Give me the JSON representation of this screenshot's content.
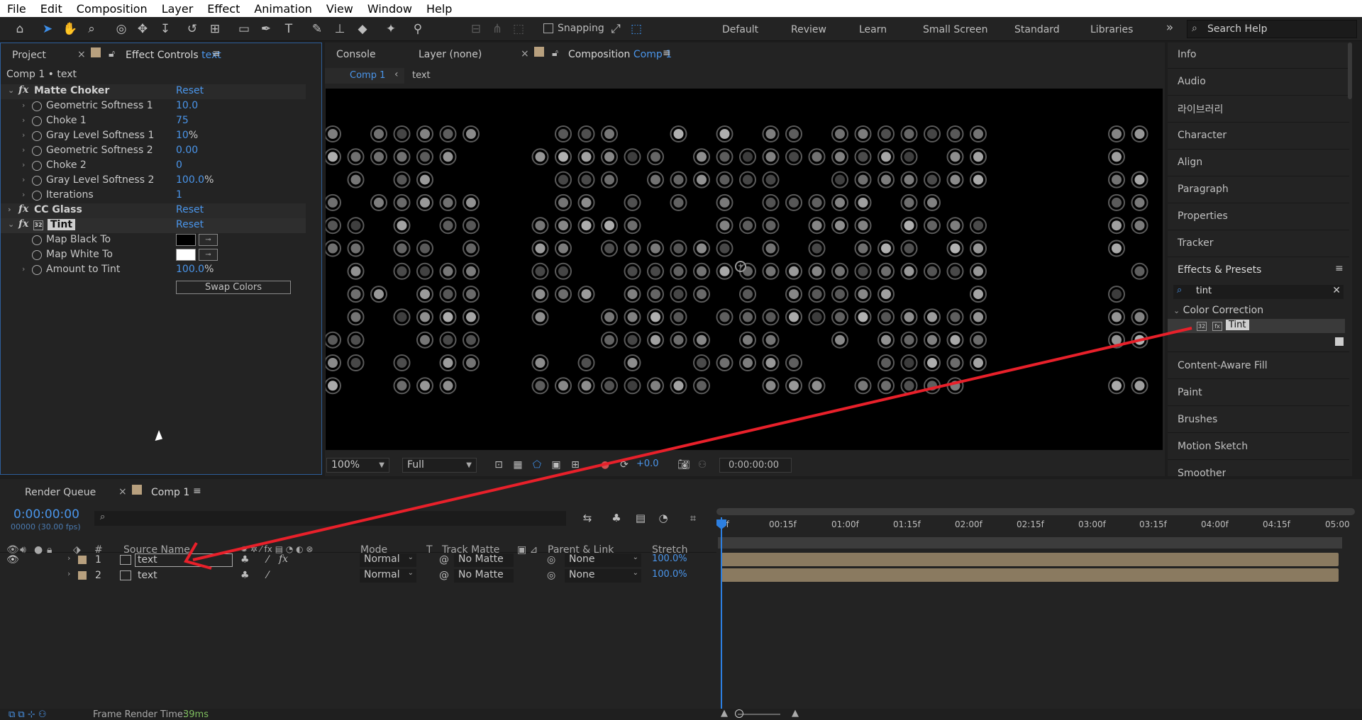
{
  "menu": [
    "File",
    "Edit",
    "Composition",
    "Layer",
    "Effect",
    "Animation",
    "View",
    "Window",
    "Help"
  ],
  "toolbar": {
    "snapping_label": "Snapping"
  },
  "workspaces": [
    "Default",
    "Review",
    "Learn",
    "Small Screen",
    "Standard",
    "Libraries"
  ],
  "search_help": {
    "placeholder": "Search Help"
  },
  "effect_controls": {
    "tab_project": "Project",
    "tab_title": "Effect Controls",
    "tab_layer": "text",
    "breadcrumb": "Comp 1 • text",
    "effects": [
      {
        "name": "Matte Choker",
        "reset": "Reset"
      },
      {
        "name": "CC Glass",
        "reset": "Reset"
      },
      {
        "name": "Tint",
        "reset": "Reset"
      }
    ],
    "matte_choker_props": [
      {
        "name": "Geometric Softness 1",
        "value": "10.0",
        "unit": ""
      },
      {
        "name": "Choke 1",
        "value": "75",
        "unit": ""
      },
      {
        "name": "Gray Level Softness 1",
        "value": "10",
        "unit": "%"
      },
      {
        "name": "Geometric Softness 2",
        "value": "0.00",
        "unit": ""
      },
      {
        "name": "Choke 2",
        "value": "0",
        "unit": ""
      },
      {
        "name": "Gray Level Softness 2",
        "value": "100.0",
        "unit": "%"
      },
      {
        "name": "Iterations",
        "value": "1",
        "unit": ""
      }
    ],
    "tint_props": [
      {
        "name": "Map Black To",
        "color": "#000000"
      },
      {
        "name": "Map White To",
        "color": "#ffffff"
      },
      {
        "name": "Amount to Tint",
        "value": "100.0",
        "unit": "%"
      }
    ],
    "swap_colors": "Swap Colors"
  },
  "viewer": {
    "tab_console": "Console",
    "tab_layer": "Layer (none)",
    "tab_comp": "Composition",
    "tab_comp_name": "Comp 1",
    "breadcrumb_comp": "Comp 1",
    "breadcrumb_layer": "text",
    "zoom": "100%",
    "resolution": "Full",
    "exposure": "+0.0",
    "timecode": "0:00:00:00"
  },
  "right_panels": [
    "Info",
    "Audio",
    "라이브러리",
    "Character",
    "Align",
    "Paragraph",
    "Properties",
    "Tracker"
  ],
  "effects_presets": {
    "title": "Effects & Presets",
    "search_value": "tint",
    "category": "Color Correction",
    "result": "Tint",
    "lower_panels": [
      "Content-Aware Fill",
      "Paint",
      "Brushes",
      "Motion Sketch",
      "Smoother"
    ]
  },
  "timeline": {
    "tab_render": "Render Queue",
    "tab_comp": "Comp 1",
    "current_time": "0:00:00:00",
    "frame_info": "00000 (30.00 fps)",
    "search_placeholder": "",
    "headers": {
      "num": "#",
      "source": "Source Name",
      "mode": "Mode",
      "t": "T",
      "track_matte": "Track Matte",
      "parent": "Parent & Link",
      "stretch": "Stretch"
    },
    "ruler": [
      "0f",
      "00:15f",
      "01:00f",
      "01:15f",
      "02:00f",
      "02:15f",
      "03:00f",
      "03:15f",
      "04:00f",
      "04:15f",
      "05:00"
    ],
    "layers": [
      {
        "num": "1",
        "name": "text",
        "mode": "Normal",
        "matte": "No Matte",
        "parent": "None",
        "stretch": "100.0%"
      },
      {
        "num": "2",
        "name": "text",
        "mode": "Normal",
        "matte": "No Matte",
        "parent": "None",
        "stretch": "100.0%"
      }
    ]
  },
  "status": {
    "label": "Frame Render Time:",
    "value": "39ms"
  },
  "colors": {
    "accent": "#4a95ea",
    "annotation_arrow": "#e8202a",
    "layer_bar": "#8a7a60"
  }
}
